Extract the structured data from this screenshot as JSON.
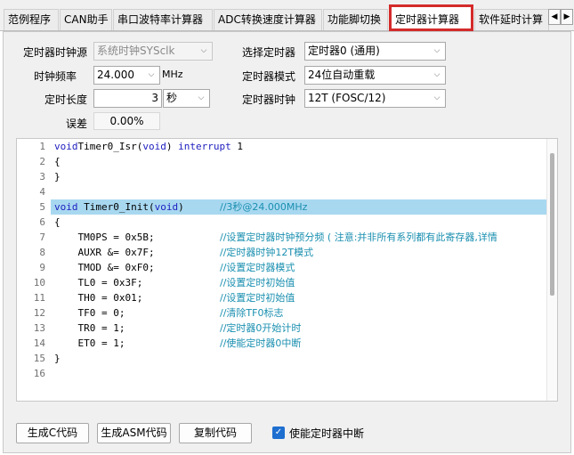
{
  "tabs": [
    {
      "label": "范例程序",
      "active": false
    },
    {
      "label": "CAN助手",
      "active": false
    },
    {
      "label": "串口波特率计算器",
      "active": false
    },
    {
      "label": "ADC转换速度计算器",
      "active": false
    },
    {
      "label": "功能脚切换",
      "active": false
    },
    {
      "label": "定时器计算器",
      "active": true
    },
    {
      "label": "软件延时计算",
      "active": false
    }
  ],
  "tab_scroll": {
    "left": "◀",
    "right": "▶"
  },
  "form": {
    "clock_source": {
      "label": "定时器时钟源",
      "value": "系统时钟SYSclk"
    },
    "clock_freq": {
      "label": "时钟频率",
      "value": "24.000",
      "unit": "MHz"
    },
    "timer_length": {
      "label": "定时长度",
      "value": "3",
      "unit": "秒"
    },
    "error": {
      "label": "误差",
      "value": "0.00%"
    },
    "select_timer": {
      "label": "选择定时器",
      "value": "定时器0 (通用)"
    },
    "timer_mode": {
      "label": "定时器模式",
      "value": "24位自动重载"
    },
    "timer_clock": {
      "label": "定时器时钟",
      "value": "12T (FOSC/12)"
    }
  },
  "code": {
    "lines": [
      {
        "n": "1",
        "parts": [
          [
            "kw",
            "void"
          ],
          [
            "",
            "Timer0_Isr("
          ],
          [
            "kw",
            "void"
          ],
          [
            "",
            ") "
          ],
          [
            "kw",
            "interrupt"
          ],
          [
            "",
            " 1"
          ]
        ],
        "comment": ""
      },
      {
        "n": "2",
        "parts": [
          [
            "",
            "{"
          ]
        ],
        "comment": ""
      },
      {
        "n": "3",
        "parts": [
          [
            "",
            "}"
          ]
        ],
        "comment": ""
      },
      {
        "n": "4",
        "parts": [],
        "comment": ""
      },
      {
        "n": "5",
        "parts": [
          [
            "kw",
            "void"
          ],
          [
            "",
            " Timer0_Init("
          ],
          [
            "kw",
            "void"
          ],
          [
            "",
            ")"
          ]
        ],
        "comment": "//3秒@24.000MHz"
      },
      {
        "n": "6",
        "parts": [
          [
            "",
            "{"
          ]
        ],
        "comment": ""
      },
      {
        "n": "7",
        "parts": [
          [
            "",
            "    TM0PS = 0x5B;"
          ]
        ],
        "comment": "//设置定时器时钟预分频 ( 注意:并非所有系列都有此寄存器,详情"
      },
      {
        "n": "8",
        "parts": [
          [
            "",
            "    AUXR &= 0x7F;"
          ]
        ],
        "comment": "//定时器时钟12T模式"
      },
      {
        "n": "9",
        "parts": [
          [
            "",
            "    TMOD &= 0xF0;"
          ]
        ],
        "comment": "//设置定时器模式"
      },
      {
        "n": "10",
        "parts": [
          [
            "",
            "    TL0 = 0x3F;"
          ]
        ],
        "comment": "//设置定时初始值"
      },
      {
        "n": "11",
        "parts": [
          [
            "",
            "    TH0 = 0x01;"
          ]
        ],
        "comment": "//设置定时初始值"
      },
      {
        "n": "12",
        "parts": [
          [
            "",
            "    TF0 = 0;"
          ]
        ],
        "comment": "//清除TF0标志"
      },
      {
        "n": "13",
        "parts": [
          [
            "",
            "    TR0 = 1;"
          ]
        ],
        "comment": "//定时器0开始计时"
      },
      {
        "n": "14",
        "parts": [
          [
            "",
            "    ET0 = 1;"
          ]
        ],
        "comment": "//使能定时器0中断"
      },
      {
        "n": "15",
        "parts": [
          [
            "",
            "}"
          ]
        ],
        "comment": ""
      },
      {
        "n": "16",
        "parts": [],
        "comment": ""
      }
    ],
    "highlighted_line": "5"
  },
  "buttons": {
    "gen_c": "生成C代码",
    "gen_asm": "生成ASM代码",
    "copy": "复制代码"
  },
  "enable_interrupt": {
    "label": "使能定时器中断",
    "checked": true
  },
  "colors": {
    "active_tab_border": "#d42a2a",
    "highlight": "#a8d8f0",
    "comment": "#1a8fb0",
    "keyword": "#2020c0",
    "checkbox": "#1e6fd0"
  }
}
